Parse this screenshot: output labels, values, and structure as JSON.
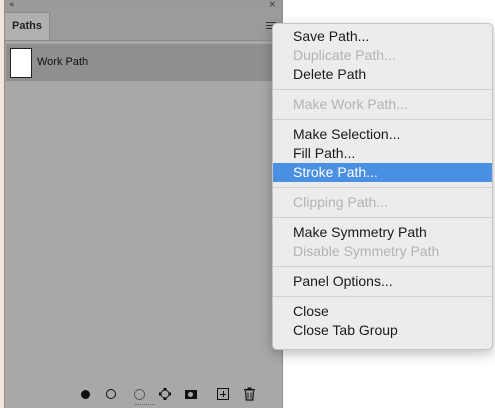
{
  "panel": {
    "collapse_glyph": "«",
    "close_glyph": "×",
    "tab_label": "Paths",
    "paths": [
      {
        "label": "Work Path",
        "selected": true
      }
    ],
    "footer_icons": [
      "fill-path-icon",
      "stroke-path-icon",
      "load-selection-icon",
      "make-work-path-icon",
      "add-mask-icon",
      "new-path-icon",
      "delete-path-icon"
    ]
  },
  "menu": {
    "items": [
      {
        "label": "Save Path...",
        "disabled": false
      },
      {
        "label": "Duplicate Path...",
        "disabled": true
      },
      {
        "label": "Delete Path",
        "disabled": false
      },
      {
        "separator": true
      },
      {
        "label": "Make Work Path...",
        "disabled": true
      },
      {
        "separator": true
      },
      {
        "label": "Make Selection...",
        "disabled": false
      },
      {
        "label": "Fill Path...",
        "disabled": false
      },
      {
        "label": "Stroke Path...",
        "disabled": false,
        "highlighted": true
      },
      {
        "separator": true
      },
      {
        "label": "Clipping Path...",
        "disabled": true
      },
      {
        "separator": true
      },
      {
        "label": "Make Symmetry Path",
        "disabled": false
      },
      {
        "label": "Disable Symmetry Path",
        "disabled": true
      },
      {
        "separator": true
      },
      {
        "label": "Panel Options...",
        "disabled": false
      },
      {
        "separator": true
      },
      {
        "label": "Close",
        "disabled": false
      },
      {
        "label": "Close Tab Group",
        "disabled": false
      }
    ]
  },
  "colors": {
    "highlight": "#4a90e2",
    "panel_bg": "#a8a8a8",
    "selected_row": "#8f8f8f",
    "menu_bg": "#ececec"
  }
}
